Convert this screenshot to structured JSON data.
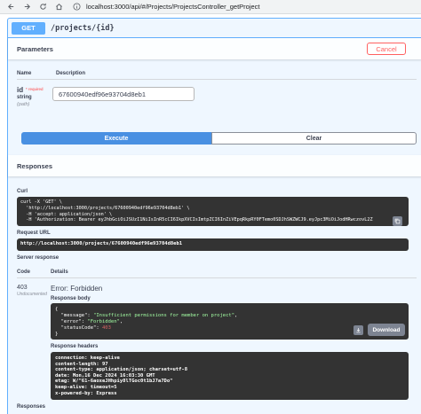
{
  "browser": {
    "url": "localhost:3000/api/#/Projects/ProjectsController_getProject"
  },
  "operation": {
    "method": "GET",
    "path": "/projects/{id}"
  },
  "parameters": {
    "title": "Parameters",
    "cancel_label": "Cancel",
    "col_name": "Name",
    "col_description": "Description",
    "param": {
      "name": "id",
      "required": "* required",
      "type": "string",
      "location": "(path)",
      "value": "67600940edf96e93704d8eb1"
    }
  },
  "actions": {
    "execute_label": "Execute",
    "clear_label": "Clear"
  },
  "responses": {
    "title": "Responses",
    "curl_label": "Curl",
    "curl_lines": [
      "curl -X 'GET' \\",
      "  'http://localhost:3000/projects/67600940edf96e93704d8eb1' \\",
      "  -H 'accept: application/json' \\",
      "  -H 'Authorization: Bearer eyJhbGciOiJSUzI1NiIsInR5cCI6IkpXVCIsImtpZCI6InZiVEpqRkpRY0FTemo0SDJhSWZWCJ9.eyJpc3MiOiJodHRwczovL2Z"
    ],
    "request_url_label": "Request URL",
    "request_url": "http://localhost:3000/projects/67600940edf96e93704d8eb1",
    "server_response_label": "Server response",
    "col_code": "Code",
    "col_details": "Details",
    "code": "403",
    "code_note": "Undocumented",
    "error_title": "Error: Forbidden",
    "body_label": "Response body",
    "body": {
      "open": "{",
      "message_key": "\"message\": ",
      "message_val": "\"Insufficient permissions for member on project\"",
      "error_key": "\"error\": ",
      "error_val": "\"Forbidden\"",
      "status_key": "\"statusCode\": ",
      "status_val": "403",
      "close": "}"
    },
    "download_label": "Download",
    "headers_label": "Response headers",
    "headers_lines": [
      "connection: keep-alive",
      "content-length: 97",
      "content-type: application/json; charset=utf-8",
      "date: Mon,16 Dec 2024 16:03:30 GMT",
      "etag: W/\"61-6aoxeJHhpiy8lTGoc0t1bJ7a7Do\"",
      "keep-alive: timeout=5",
      "x-powered-by: Express"
    ],
    "responses_footer": "Responses"
  },
  "colors": {
    "get": "#61affe",
    "execute": "#4990e2",
    "cancel": "#ff6060",
    "code_bg": "#333333"
  },
  "icons": {
    "back": "arrow-left-icon",
    "forward": "arrow-right-icon",
    "reload": "reload-icon",
    "home": "home-icon",
    "lock": "info-lock-icon",
    "copy": "copy-icon",
    "download": "download-icon"
  }
}
